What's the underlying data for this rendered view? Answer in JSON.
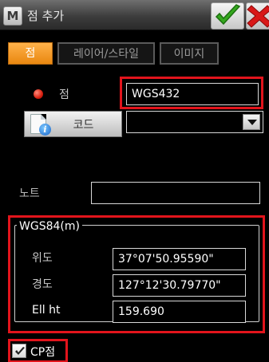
{
  "app": {
    "icon_letter": "M",
    "title": "점 추가"
  },
  "tabs": [
    {
      "label": "점",
      "active": true
    },
    {
      "label": "레이어/스타일",
      "active": false
    },
    {
      "label": "이미지",
      "active": false
    }
  ],
  "point": {
    "label": "점",
    "value": "WGS432",
    "status_color": "#d82010"
  },
  "code": {
    "button_label": "코드",
    "selected": ""
  },
  "note": {
    "label": "노트",
    "value": ""
  },
  "coords": {
    "group_label": "WGS84(m)",
    "lat_label": "위도",
    "lat_value": "37°07'50.95590\"",
    "lon_label": "경도",
    "lon_value": "127°12'30.79770\"",
    "ell_label": "Ell ht",
    "ell_value": "159.690"
  },
  "cp": {
    "label": "CP점",
    "checked": true
  },
  "colors": {
    "accent": "#e98710",
    "highlight": "#e2141c",
    "ok": "#2e9e1a",
    "cancel": "#cc1010"
  },
  "icons": {
    "ok": "check-icon",
    "cancel": "close-icon",
    "code": "document-info-icon",
    "dropdown": "chevron-down-icon"
  }
}
